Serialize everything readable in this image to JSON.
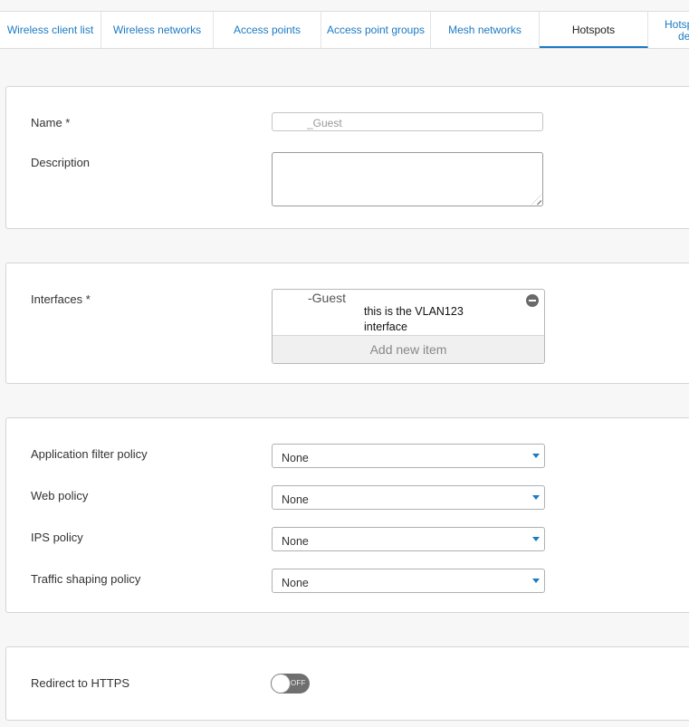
{
  "tabs": [
    {
      "label": "Wireless client list"
    },
    {
      "label": "Wireless networks"
    },
    {
      "label": "Access points"
    },
    {
      "label": "Access point groups"
    },
    {
      "label": "Mesh networks"
    },
    {
      "label": "Hotspots"
    },
    {
      "label": "Hotsp...",
      "line1": "Hotsp",
      "line2": "de"
    }
  ],
  "general": {
    "name_label": "Name *",
    "name_value": "_Guest",
    "description_label": "Description",
    "description_value": ""
  },
  "interfaces": {
    "label": "Interfaces *",
    "items": [
      {
        "value": "-Guest",
        "note": "this is the VLAN123 interface"
      }
    ],
    "add_label": "Add new item"
  },
  "policies": {
    "app_filter_label": "Application filter policy",
    "app_filter_value": "None",
    "web_label": "Web policy",
    "web_value": "None",
    "ips_label": "IPS policy",
    "ips_value": "None",
    "traffic_label": "Traffic shaping policy",
    "traffic_value": "None"
  },
  "redirect": {
    "label": "Redirect to HTTPS",
    "state": "OFF"
  },
  "colors": {
    "accent": "#1a7ac4",
    "toggle_off": "#6f6f6f"
  }
}
